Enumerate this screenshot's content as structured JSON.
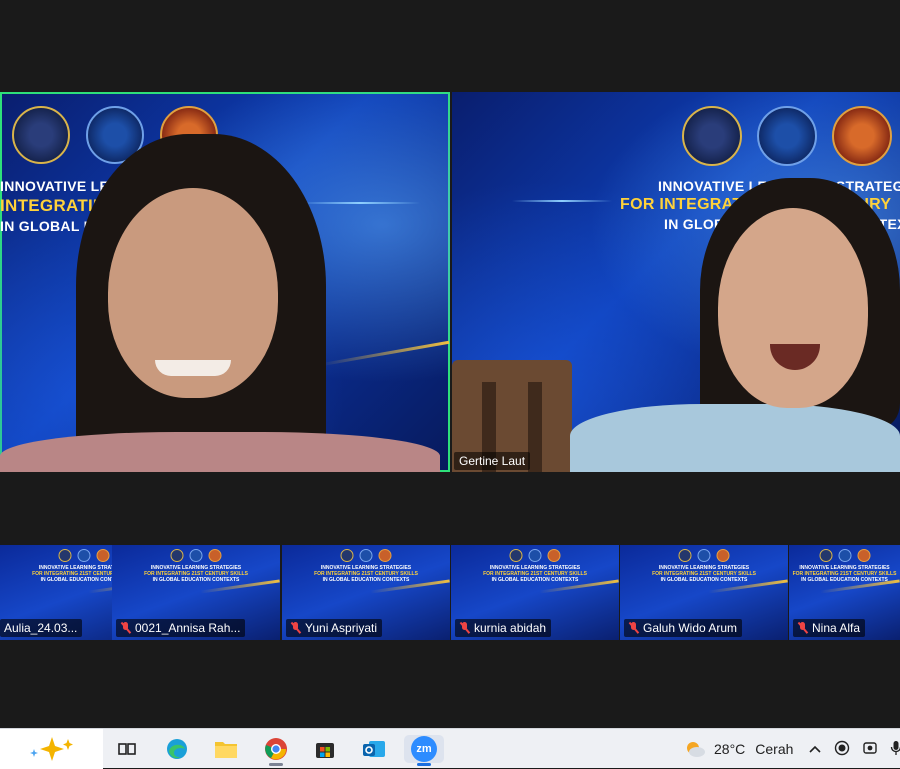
{
  "main_tiles": [
    {
      "name": "",
      "banner": {
        "line1": "INNOVATIVE LEA",
        "line2": "INTEGRATING",
        "line3": "IN GLOBAL E"
      }
    },
    {
      "name": "Gertine Laut",
      "banner": {
        "line1": "INNOVATIVE LEA",
        "line1b": "D STRATEGI",
        "line2": "FOR INTEGRAT",
        "line2b": "TURY",
        "line3": "IN GLOB",
        "line3b": "TEXT"
      }
    }
  ],
  "gallery": [
    {
      "name": "Aulia_24.03..."
    },
    {
      "name": "0021_Annisa Rah..."
    },
    {
      "name": "Yuni Aspriyati"
    },
    {
      "name": "kurnia abidah"
    },
    {
      "name": "Galuh Wido Arum"
    },
    {
      "name": "Nina Alfa"
    }
  ],
  "mini_banner": {
    "line1": "INNOVATIVE LEARNING STRATEGIES",
    "line2": "FOR INTEGRATING 21ST CENTURY SKILLS",
    "line3": "IN GLOBAL EDUCATION CONTEXTS"
  },
  "taskbar": {
    "apps": [
      "task-view",
      "edge",
      "file-explorer",
      "chrome",
      "store",
      "outlook",
      "zoom"
    ],
    "zoom_label": "zm",
    "weather": {
      "temp": "28°C",
      "condition": "Cerah"
    }
  },
  "colors": {
    "active_speaker": "#2ee07a",
    "mic_muted": "#ee4444"
  }
}
